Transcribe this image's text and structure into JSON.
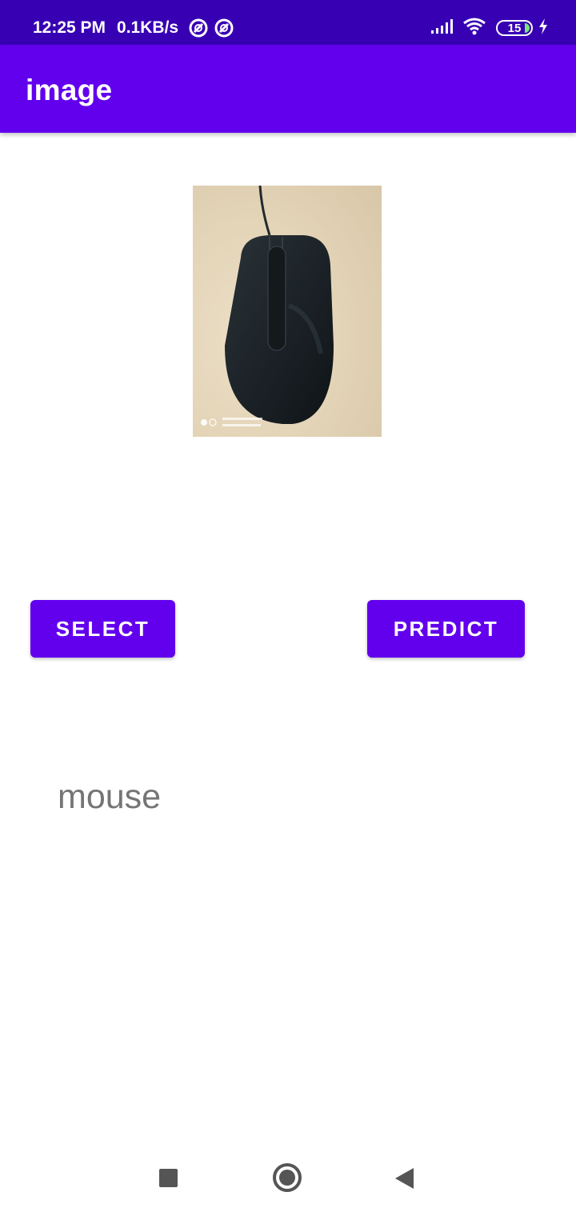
{
  "status_bar": {
    "time": "12:25 PM",
    "speed": "0.1KB/s",
    "battery_level": "15",
    "icons": [
      "sync-icon",
      "no-disturb-icon",
      "signal-icon",
      "wifi-icon",
      "battery-icon",
      "charging-icon"
    ]
  },
  "app_bar": {
    "title": "image"
  },
  "image_view": {
    "icon": "mouse-photo"
  },
  "buttons": {
    "select_label": "SELECT",
    "predict_label": "PREDICT"
  },
  "result": {
    "text": "mouse"
  },
  "nav_bar": {
    "icons": [
      "recent-apps-icon",
      "home-icon",
      "back-icon"
    ]
  },
  "colors": {
    "status_bar": "#3700B3",
    "primary": "#6200EE",
    "result_text": "#757575"
  }
}
